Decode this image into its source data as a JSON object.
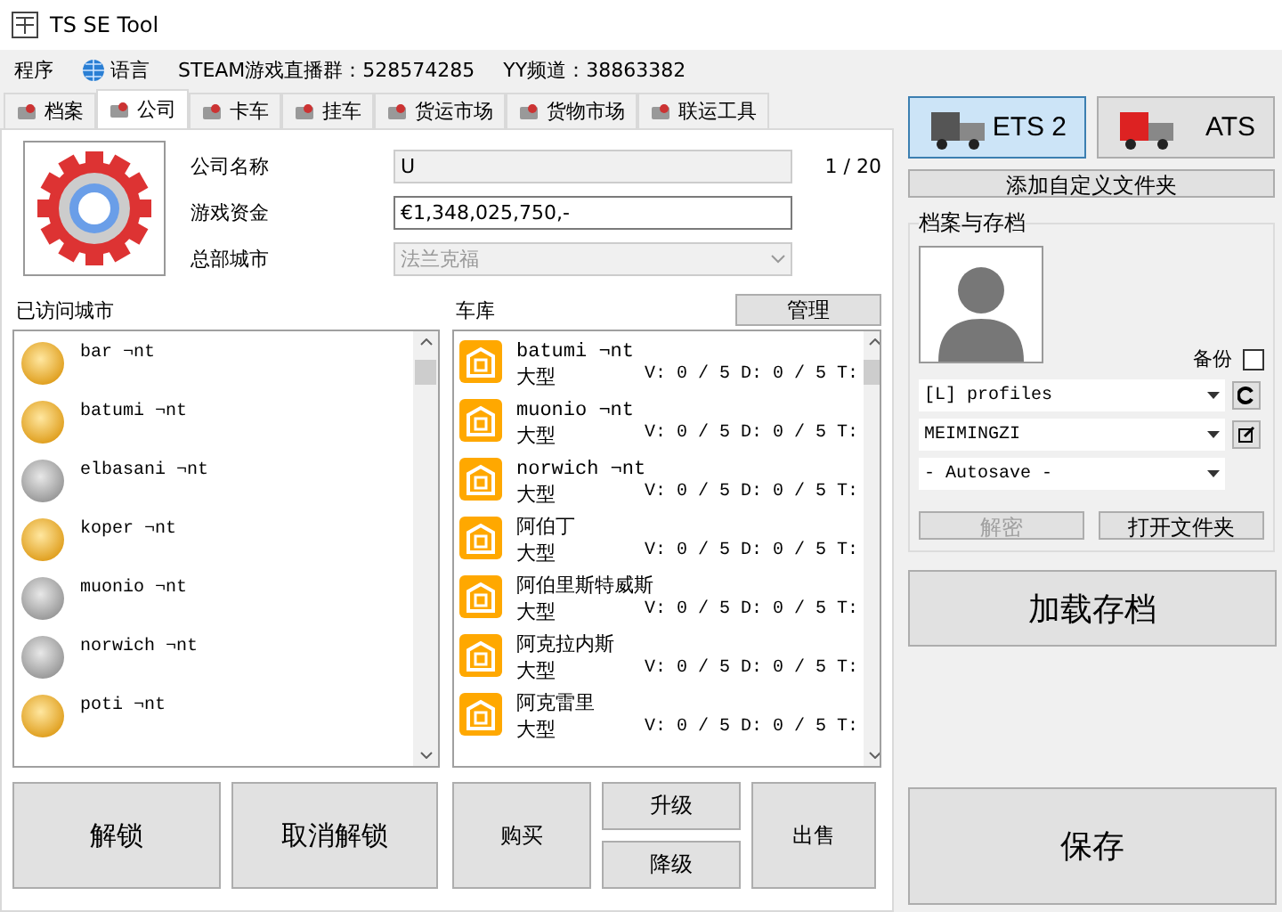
{
  "window": {
    "title": "TS SE Tool"
  },
  "menu": [
    {
      "label": "程序",
      "kind": "text"
    },
    {
      "label": "语言",
      "kind": "globe"
    },
    {
      "label": "STEAM游戏直播群：528574285",
      "kind": "text"
    },
    {
      "label": "YY频道：38863382",
      "kind": "text"
    }
  ],
  "tabs": [
    {
      "label": "档案",
      "selected": false
    },
    {
      "label": "公司",
      "selected": true
    },
    {
      "label": "卡车",
      "selected": false
    },
    {
      "label": "挂车",
      "selected": false
    },
    {
      "label": "货运市场",
      "selected": false
    },
    {
      "label": "货物市场",
      "selected": false
    },
    {
      "label": "联运工具",
      "selected": false
    }
  ],
  "company": {
    "name_label": "公司名称",
    "name_value": "U",
    "name_counter": "1 / 20",
    "money_label": "游戏资金",
    "money_value": "€1,348,025,750,-",
    "hq_label": "总部城市",
    "hq_value": "法兰克福",
    "hq_disabled": true
  },
  "visited_cities": {
    "title": "已访问城市",
    "items": [
      {
        "name": "bar ¬nt",
        "visited": true
      },
      {
        "name": "batumi ¬nt",
        "visited": true
      },
      {
        "name": "elbasani ¬nt",
        "visited": false
      },
      {
        "name": "koper ¬nt",
        "visited": true
      },
      {
        "name": "muonio ¬nt",
        "visited": false
      },
      {
        "name": "norwich ¬nt",
        "visited": false
      },
      {
        "name": "poti ¬nt",
        "visited": true
      }
    ]
  },
  "garages": {
    "title": "车库",
    "manage_button": "管理",
    "items": [
      {
        "name": "batumi ¬nt",
        "size": "大型",
        "stats": "V: 0 / 5 D: 0 / 5 T:"
      },
      {
        "name": "muonio ¬nt",
        "size": "大型",
        "stats": "V: 0 / 5 D: 0 / 5 T:"
      },
      {
        "name": "norwich ¬nt",
        "size": "大型",
        "stats": "V: 0 / 5 D: 0 / 5 T:"
      },
      {
        "name": "阿伯丁",
        "size": "大型",
        "stats": "V: 0 / 5 D: 0 / 5 T:"
      },
      {
        "name": "阿伯里斯特威斯",
        "size": "大型",
        "stats": "V: 0 / 5 D: 0 / 5 T:"
      },
      {
        "name": "阿克拉内斯",
        "size": "大型",
        "stats": "V: 0 / 5 D: 0 / 5 T:"
      },
      {
        "name": "阿克雷里",
        "size": "大型",
        "stats": "V: 0 / 5 D: 0 / 5 T:"
      }
    ]
  },
  "city_buttons": [
    "解锁",
    "取消解锁"
  ],
  "garage_buttons": {
    "buy": "购买",
    "upgrade": "升级",
    "downgrade": "降级",
    "sell": "出售"
  },
  "games": [
    {
      "label": "ETS 2",
      "selected": true
    },
    {
      "label": "ATS",
      "selected": false
    }
  ],
  "add_folder_button": "添加自定义文件夹",
  "profiles": {
    "title": "档案与存档",
    "backup_label": "备份",
    "backup_checked": false,
    "folder": "[L] profiles",
    "profile": "MEIMINGZI",
    "save": "- Autosave -",
    "decrypt_button": "解密",
    "decrypt_disabled": true,
    "open_folder_button": "打开文件夹"
  },
  "load_button": "加载存档",
  "save_button": "保存"
}
